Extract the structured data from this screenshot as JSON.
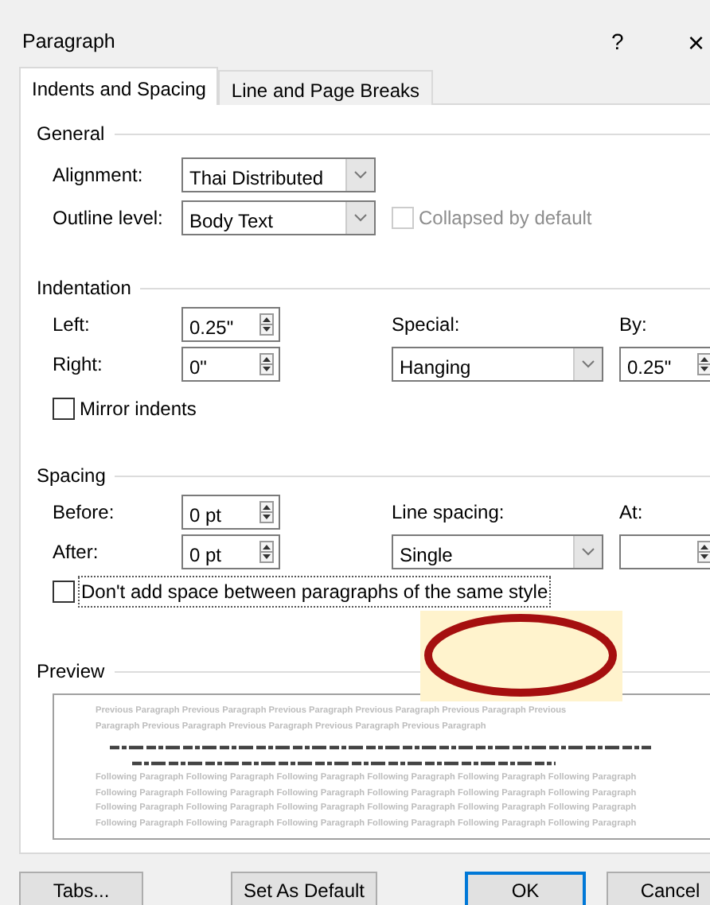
{
  "window": {
    "title": "Paragraph",
    "help": "?",
    "close": "×"
  },
  "tabs": [
    {
      "label": "Indents and Spacing",
      "selected": true
    },
    {
      "label": "Line and Page Breaks",
      "selected": false
    }
  ],
  "general": {
    "heading": "General",
    "alignment": {
      "label": "Alignment:",
      "value": "Thai Distributed"
    },
    "outline_level": {
      "label": "Outline level:",
      "value": "Body Text"
    },
    "collapsed": {
      "label": "Collapsed by default",
      "checked": false,
      "disabled": true
    }
  },
  "indentation": {
    "heading": "Indentation",
    "left": {
      "label": "Left:",
      "value": "0.25\""
    },
    "right": {
      "label": "Right:",
      "value": "0\""
    },
    "special": {
      "label": "Special:",
      "value": "Hanging"
    },
    "by": {
      "label": "By:",
      "value": "0.25\""
    },
    "mirror": {
      "label": "Mirror indents",
      "checked": false
    }
  },
  "spacing": {
    "heading": "Spacing",
    "before": {
      "label": "Before:",
      "value": "0 pt"
    },
    "after": {
      "label": "After:",
      "value": "0 pt"
    },
    "line_spacing": {
      "label": "Line spacing:",
      "value": "Single"
    },
    "at": {
      "label": "At:"
    },
    "dont_add": {
      "label": "Don't add space between paragraphs of the same style",
      "checked": false
    }
  },
  "preview": {
    "heading": "Preview",
    "previous": [
      "Previous Paragraph Previous Paragraph Previous Paragraph Previous Paragraph Previous Paragraph Previous",
      "Paragraph Previous Paragraph Previous Paragraph Previous Paragraph Previous Paragraph"
    ],
    "following": [
      "Following Paragraph Following Paragraph Following Paragraph Following Paragraph Following Paragraph Following Paragraph",
      "Following Paragraph Following Paragraph Following Paragraph Following Paragraph Following Paragraph Following Paragraph",
      "Following Paragraph Following Paragraph Following Paragraph Following Paragraph Following Paragraph Following Paragraph",
      "Following Paragraph Following Paragraph Following Paragraph Following Paragraph Following Paragraph Following Paragraph"
    ]
  },
  "buttons": [
    {
      "label": "Tabs...",
      "default": false
    },
    {
      "label": "Set As Default",
      "default": false
    },
    {
      "label": "OK",
      "default": true
    },
    {
      "label": "Cancel",
      "default": false
    }
  ]
}
